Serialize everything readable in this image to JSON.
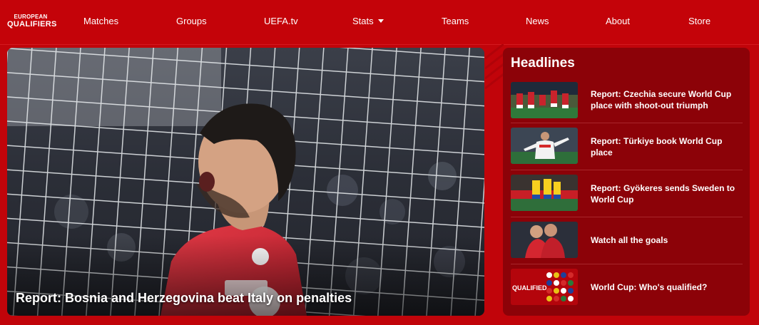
{
  "brand": {
    "line1": "EUROPEAN",
    "line2": "QUALIFIERS",
    "logo_icon": "european-qualifiers-logo"
  },
  "nav": {
    "items": [
      {
        "label": "Matches"
      },
      {
        "label": "Groups"
      },
      {
        "label": "UEFA.tv"
      },
      {
        "label": "Stats",
        "icon": "chevron-down-icon"
      },
      {
        "label": "Teams"
      },
      {
        "label": "News"
      },
      {
        "label": "About"
      },
      {
        "label": "Store"
      }
    ]
  },
  "hero": {
    "title": "Report: Bosnia and Herzegovina beat Italy on penalties",
    "image": "player-celebrating-in-front-of-net"
  },
  "headlines": {
    "title": "Headlines",
    "items": [
      {
        "text": "Report: Czechia secure World Cup place with shoot-out triumph",
        "image": "czechia-players-celebrating"
      },
      {
        "text": "Report: Türkiye book World Cup place",
        "image": "turkiye-player-celebrating"
      },
      {
        "text": "Report: Gyökeres sends Sweden to World Cup",
        "image": "sweden-players-celebrating"
      },
      {
        "text": "Watch all the goals",
        "image": "players-embracing"
      },
      {
        "text": "World Cup: Who's qualified?",
        "image": "qualified-flags-graphic"
      }
    ]
  },
  "colors": {
    "background": "#c1040a",
    "headlines_panel": "#8c0208",
    "text": "#ffffff"
  }
}
